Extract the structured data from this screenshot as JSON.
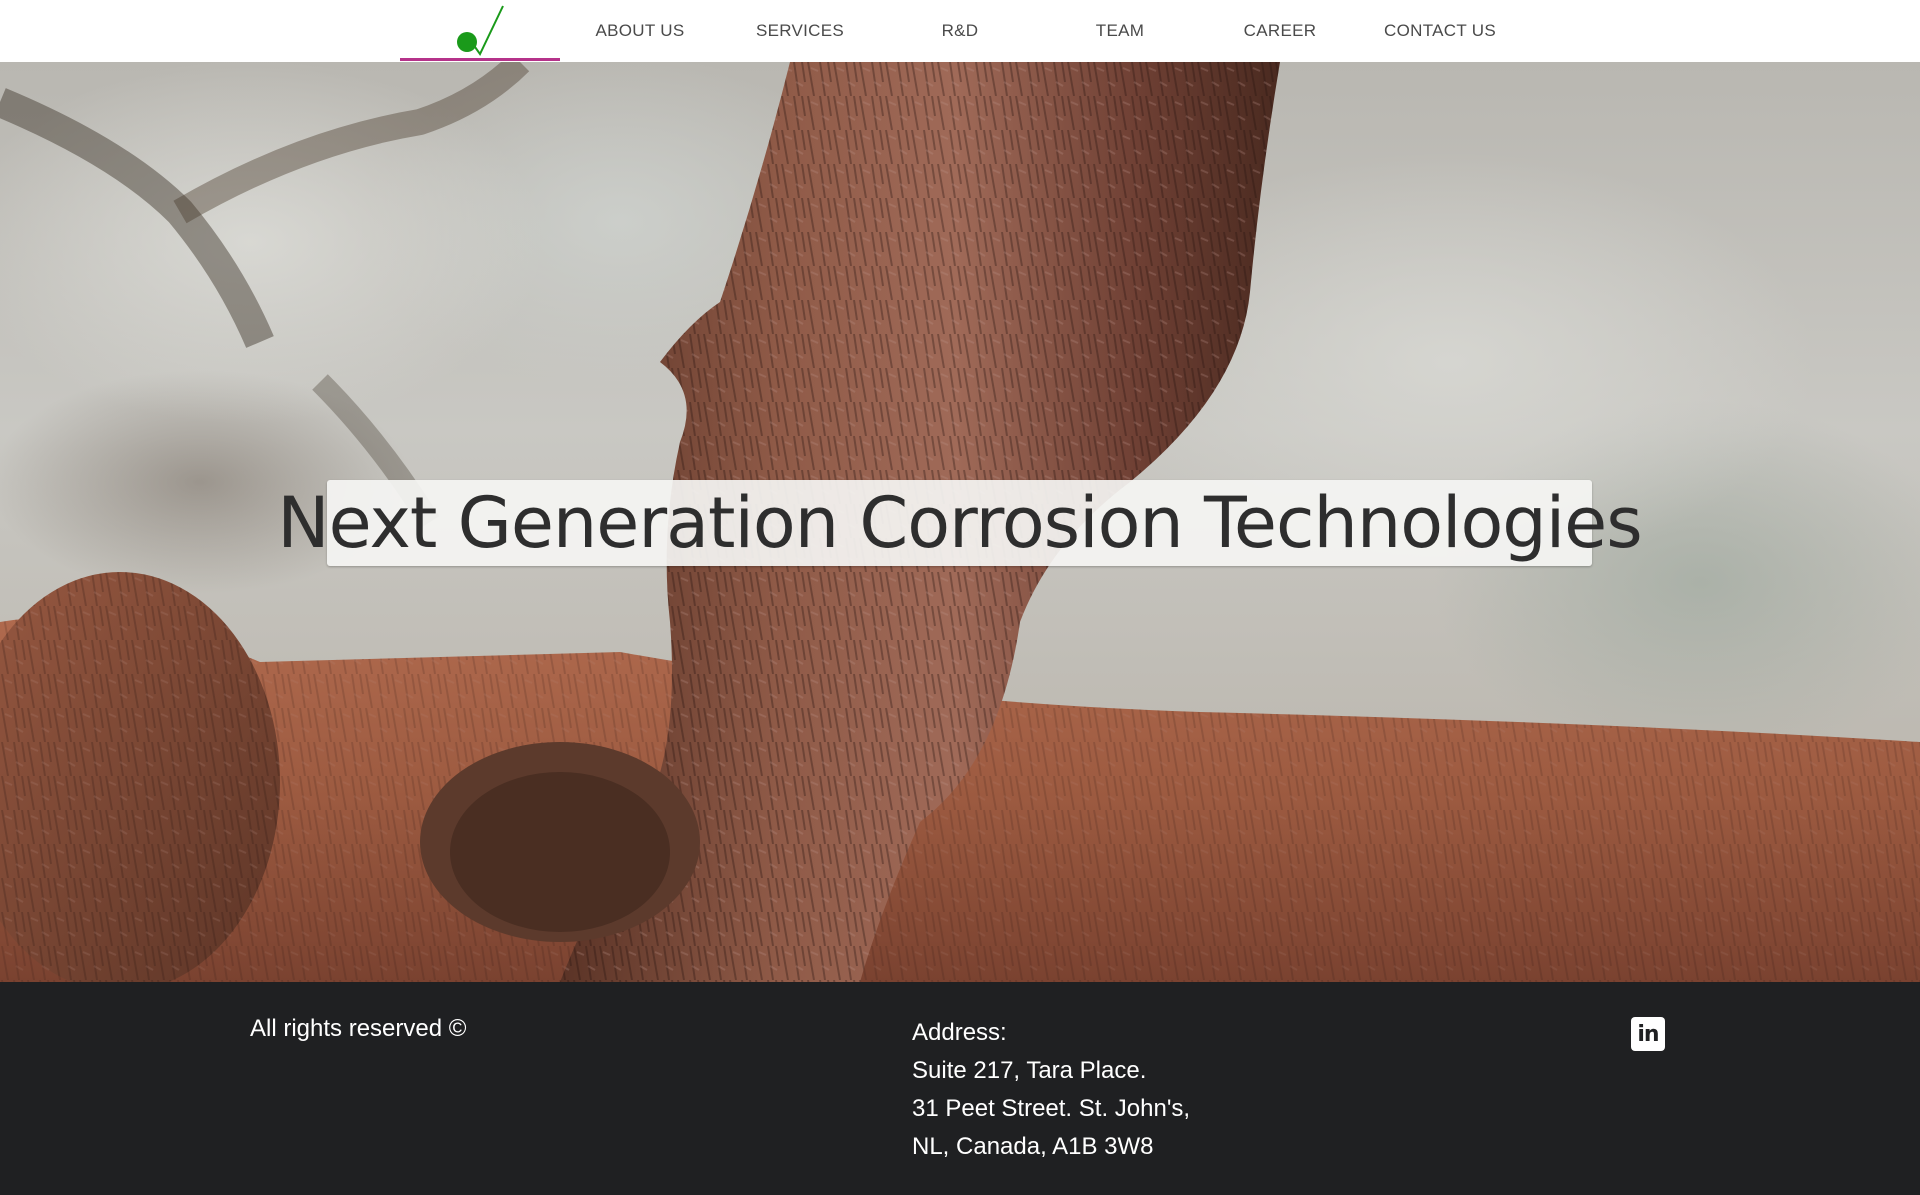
{
  "header": {
    "logo_icon": "checkmark-dot-logo-icon",
    "accent_color": "#b5338a",
    "logo_color": "#1a9a1a",
    "nav": [
      {
        "label": "ABOUT US"
      },
      {
        "label": "SERVICES"
      },
      {
        "label": "R&D"
      },
      {
        "label": "TEAM"
      },
      {
        "label": "CAREER"
      },
      {
        "label": "CONTACT US"
      }
    ]
  },
  "hero": {
    "headline": "Next Generation Corrosion Technologies"
  },
  "footer": {
    "rights": "All rights reserved ©",
    "address_lines": [
      "Address:",
      "Suite 217, Tara Place.",
      "31 Peet Street. St. John's,",
      "NL, Canada, A1B 3W8"
    ],
    "social_icon": "linkedin-icon",
    "linkedin_glyph": "in",
    "background_color": "#1f2022"
  }
}
